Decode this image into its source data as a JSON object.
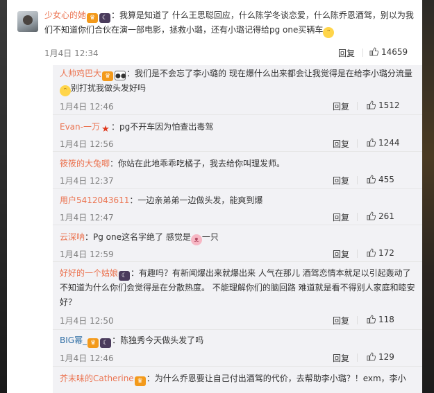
{
  "main_comment": {
    "username": "少女心的她",
    "text": "：我算是知道了 什么王思聪回应，什么陈学冬谈恋爱，什么陈乔恩酒驾，别以为我们不知道你们合伙在演一部电影，拯救小璐，还有小璐记得给pg one买辆车",
    "time": "1月4日 12:34",
    "reply_label": "回复",
    "likes": "14659"
  },
  "replies": [
    {
      "username": "人帅鸡巴大",
      "text": "：我们是不会忘了李小璐的 现在爆什么出来都会让我觉得是在给李小璐分流量",
      "text_2": "别打扰我做头发好吗",
      "time": "1月4日 12:46",
      "reply_label": "回复",
      "likes": "1512"
    },
    {
      "username": "Evan-一万",
      "text": "：pg不开车因为怕查出毒驾",
      "time": "1月4日 12:56",
      "reply_label": "回复",
      "likes": "1244"
    },
    {
      "username": "筱筱的大兔唧",
      "text": "：你站在此地乖乖吃橘子，我去给你叫理发师。",
      "time": "1月4日 12:37",
      "reply_label": "回复",
      "likes": "455"
    },
    {
      "username": "用户5412043611",
      "text": "：一边亲弟弟一边做头发，能爽到爆",
      "time": "1月4日 12:47",
      "reply_label": "回复",
      "likes": "261"
    },
    {
      "username": "云深呐",
      "text": "：Pg one这名字绝了 感觉是",
      "text_2": "一只",
      "time": "1月4日 12:59",
      "reply_label": "回复",
      "likes": "172"
    },
    {
      "username": "好好的一个姑娘",
      "text": "：有趣吗？有新闻爆出来就爆出来 人气在那儿 酒驾恋情本就足以引起轰动了 不知道为什么你们会觉得是在分散热度。 不能理解你们的脑回路 难道就是看不得别人家庭和睦安好？",
      "time": "1月4日 12:50",
      "reply_label": "回复",
      "likes": "118"
    },
    {
      "username": "BIG幂_",
      "text": "：陈独秀今天做头发了吗",
      "time": "1月4日 12:46",
      "reply_label": "回复",
      "likes": "129"
    },
    {
      "username": "芥末味的Catherine",
      "text": "：为什么乔恩要让自己付出酒驾的代价，去帮助李小璐？！exm，李小",
      "time": "",
      "reply_label": "",
      "likes": ""
    }
  ],
  "colors": {
    "username": "#eb7350",
    "replies_bg": "#f2f2f5",
    "time": "#808080"
  },
  "icons": {
    "like": "thumbs-up-icon",
    "vip": "vip-badge-icon",
    "night": "moon-badge-icon"
  }
}
